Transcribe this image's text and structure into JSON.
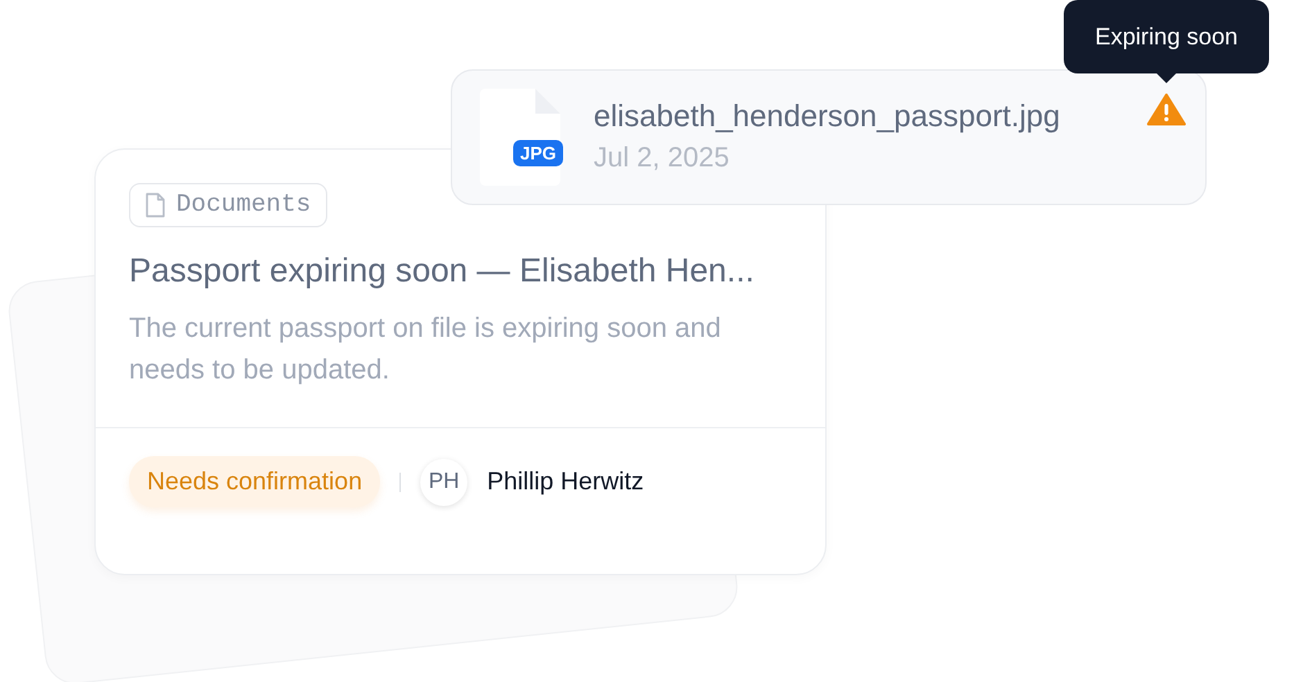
{
  "tooltip": {
    "text": "Expiring soon"
  },
  "file": {
    "type": "JPG",
    "name": "elisabeth_henderson_passport.jpg",
    "date": "Jul 2, 2025"
  },
  "card": {
    "tag": "Documents",
    "title": "Passport expiring soon — Elisabeth Hen...",
    "description": "The current passport on file is expiring soon and needs to be updated.",
    "status": "Needs confirmation",
    "assignee": {
      "initials": "PH",
      "name": "Phillip Herwitz"
    }
  }
}
